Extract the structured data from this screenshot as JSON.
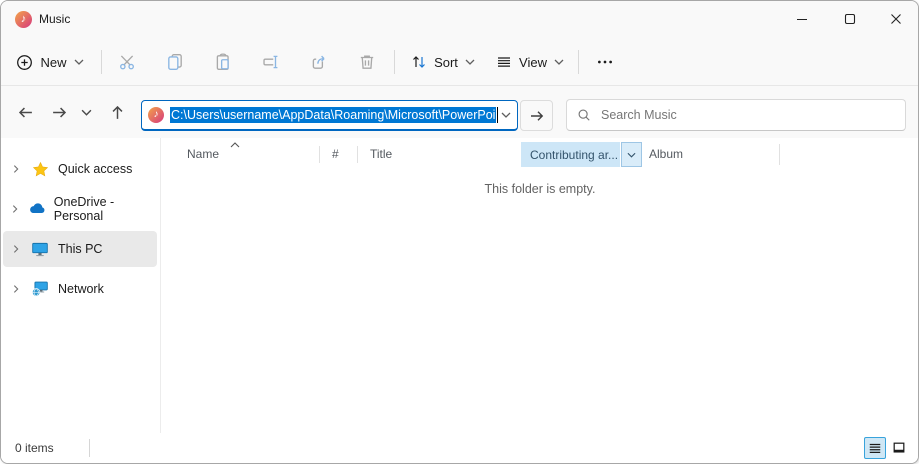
{
  "window": {
    "title": "Music"
  },
  "toolbar": {
    "new_label": "New",
    "sort_label": "Sort",
    "view_label": "View",
    "more_label": "•••"
  },
  "address_bar": {
    "value": "C:\\Users\\username\\AppData\\Roaming\\Microsoft\\PowerPoi"
  },
  "search": {
    "placeholder": "Search Music"
  },
  "sidebar": {
    "items": [
      {
        "label": "Quick access"
      },
      {
        "label": "OneDrive - Personal"
      },
      {
        "label": "This PC"
      },
      {
        "label": "Network"
      }
    ]
  },
  "list": {
    "columns": [
      {
        "label": "Name"
      },
      {
        "label": "#"
      },
      {
        "label": "Title"
      },
      {
        "label": "Contributing ar..."
      },
      {
        "label": "Album"
      }
    ],
    "empty_message": "This folder is empty."
  },
  "status_bar": {
    "items_count": "0 items"
  },
  "icons": {
    "app_glyph": "♪"
  },
  "colors": {
    "selection_blue": "#0078d4",
    "focus_border": "#0067c0",
    "header_highlight": "#cde6f7",
    "accent": "#1976d2"
  }
}
